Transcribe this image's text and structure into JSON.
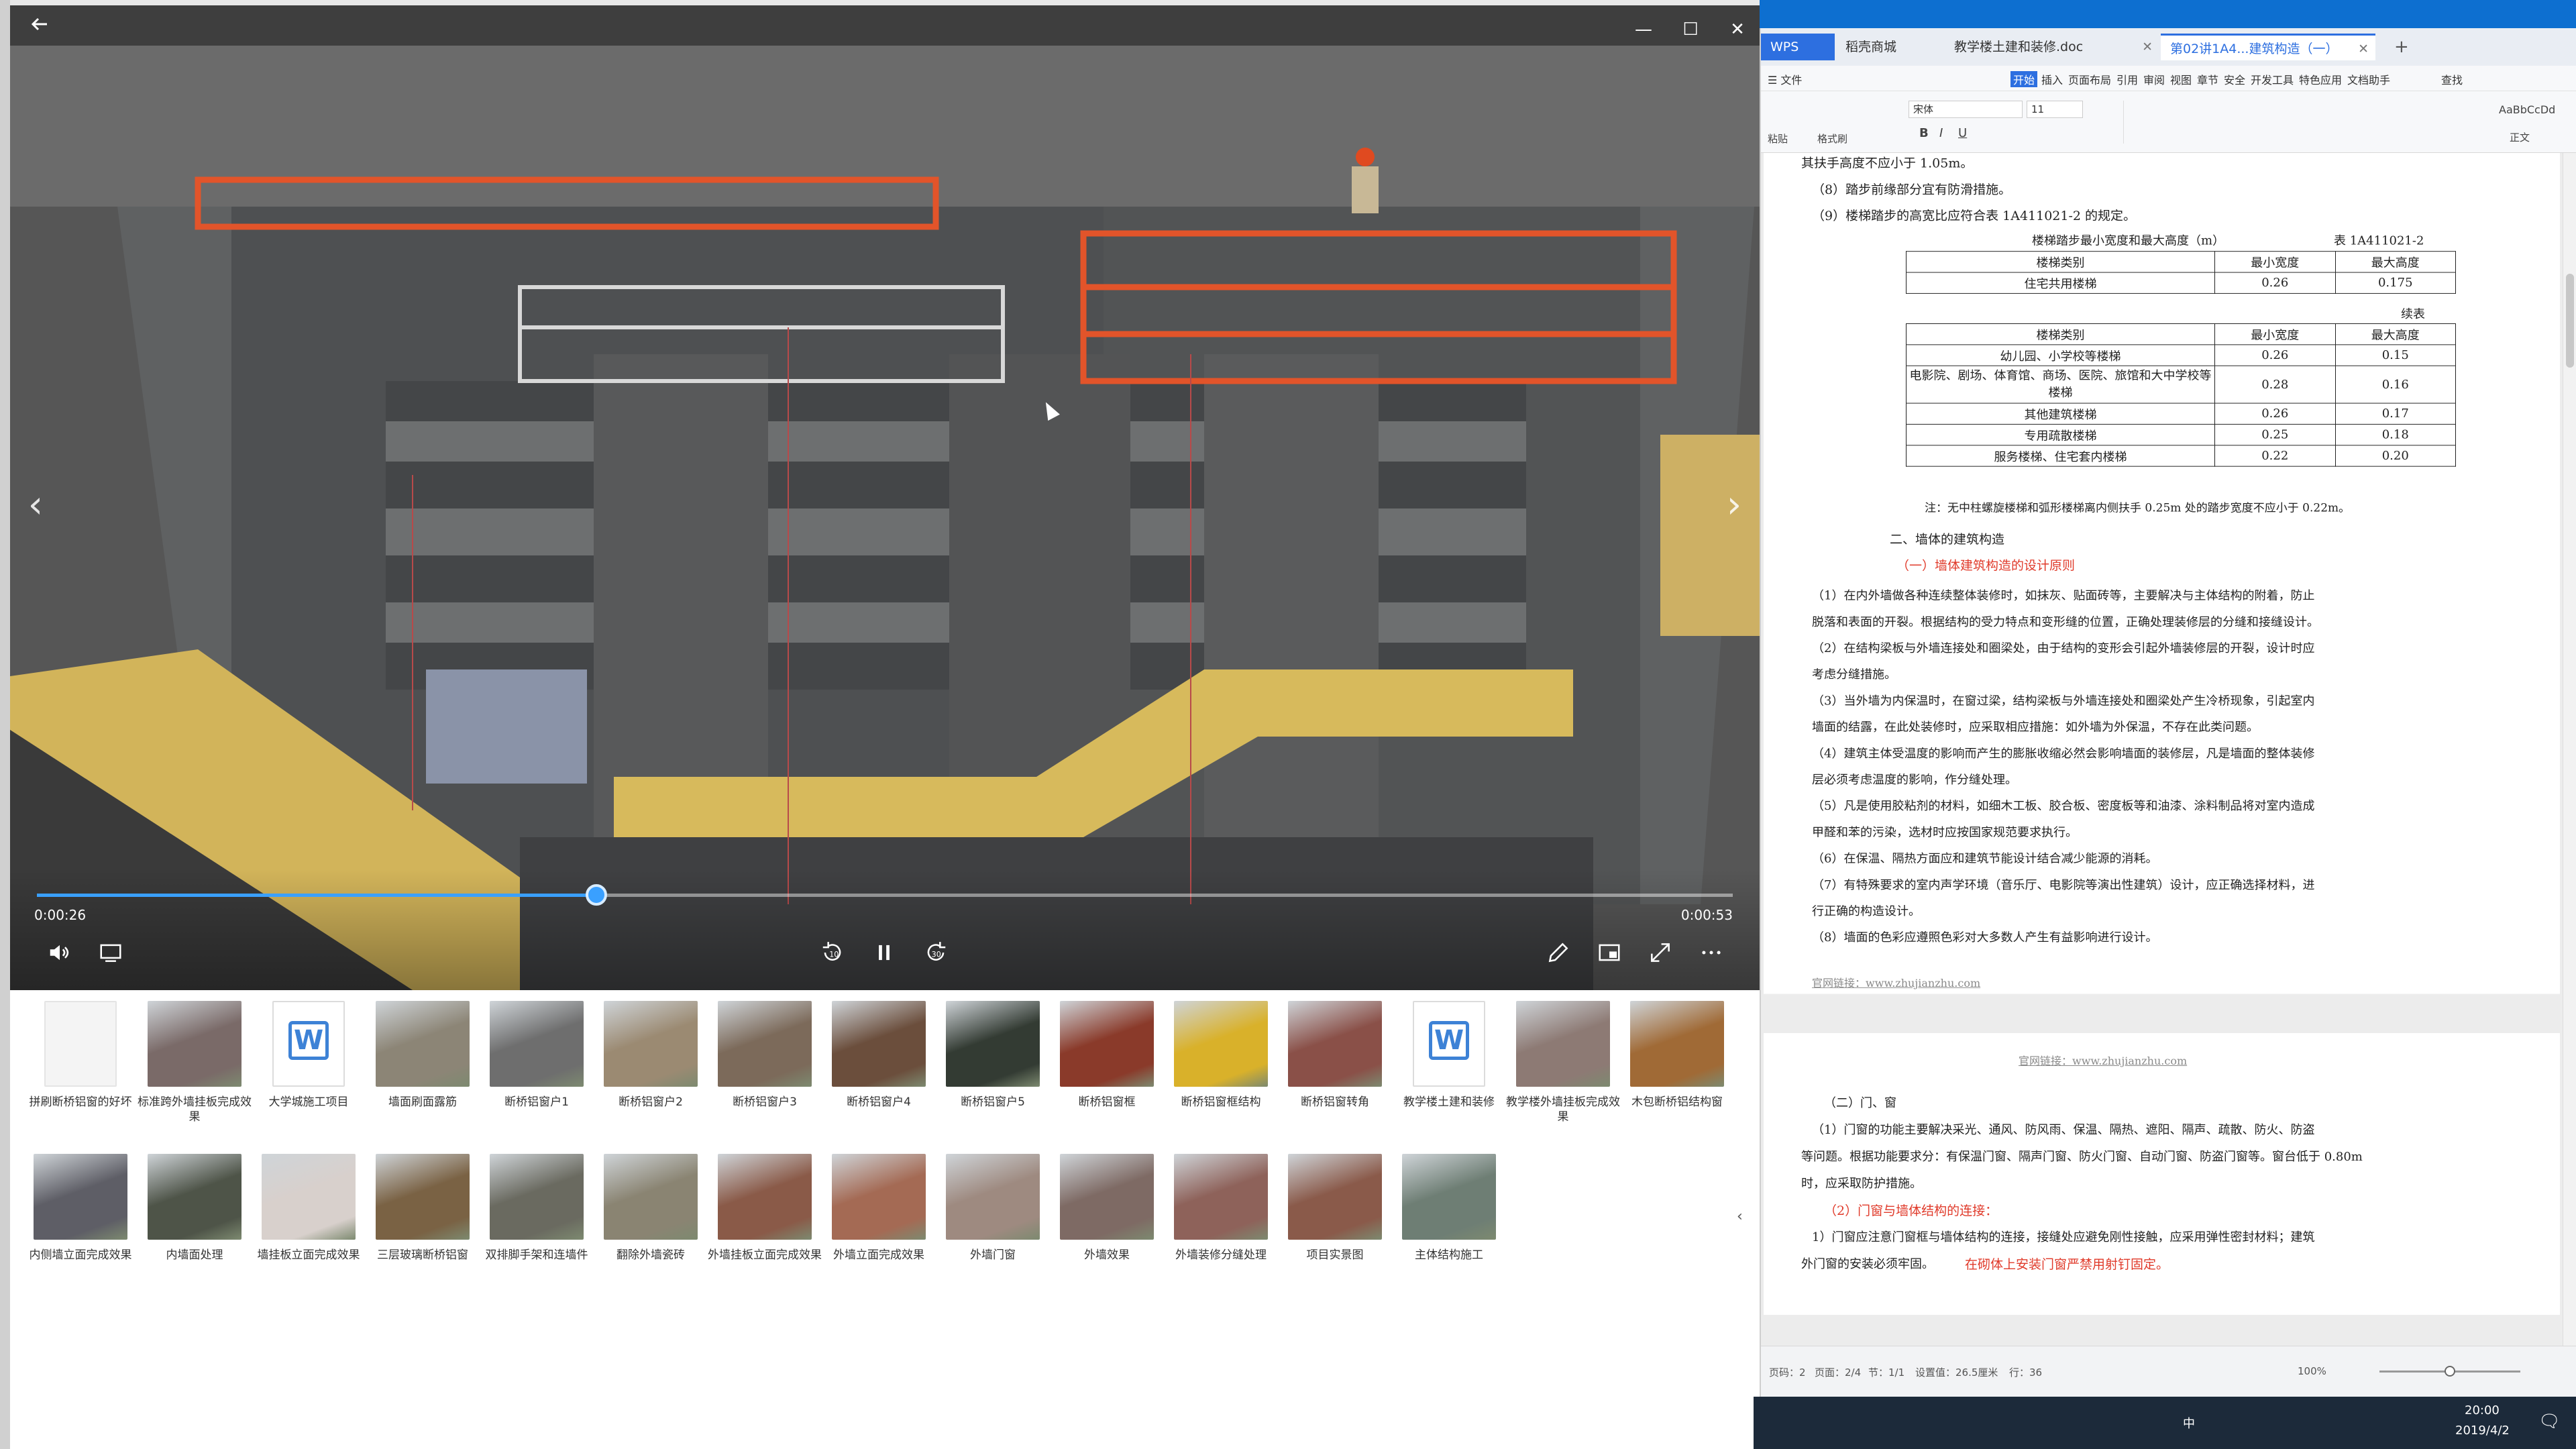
{
  "player": {
    "back_icon": "back-arrow-icon",
    "minimize_glyph": "—",
    "maximize_glyph": "☐",
    "close_glyph": "✕",
    "prev_glyph": "‹",
    "next_glyph": "›",
    "time_current": "0:00:26",
    "time_total": "0:00:53",
    "progress": 0.33,
    "rewind_label": "10",
    "forward_label": "30"
  },
  "gallery": {
    "row1": [
      {
        "label": "拼刷断桥铝窗的好坏",
        "kind": "blank"
      },
      {
        "label": "标准跨外墙挂板完成效果",
        "kind": "photo",
        "color": "#7a6a68"
      },
      {
        "label": "大学城施工项目",
        "kind": "doc"
      },
      {
        "label": "墙面刷面露筋",
        "kind": "photo",
        "color": "#8c8576"
      },
      {
        "label": "断桥铝窗户1",
        "kind": "photo",
        "color": "#6e6e6e"
      },
      {
        "label": "断桥铝窗户2",
        "kind": "photo",
        "color": "#9b8a72"
      },
      {
        "label": "断桥铝窗户3",
        "kind": "photo",
        "color": "#7c6a5a"
      },
      {
        "label": "断桥铝窗户4",
        "kind": "photo",
        "color": "#6b4e3c"
      },
      {
        "label": "断桥铝窗户5",
        "kind": "photo",
        "color": "#333b33"
      },
      {
        "label": "断桥铝窗框",
        "kind": "photo",
        "color": "#8a3a2a"
      },
      {
        "label": "断桥铝窗框结构",
        "kind": "photo",
        "color": "#d9b12a"
      },
      {
        "label": "断桥铝窗转角",
        "kind": "photo",
        "color": "#8a5048"
      },
      {
        "label": "教学楼土建和装修",
        "kind": "doc"
      },
      {
        "label": "教学楼外墙挂板完成效果",
        "kind": "photo",
        "color": "#8d7a74"
      },
      {
        "label": "木包断桥铝结构窗",
        "kind": "photo",
        "color": "#a06a36"
      }
    ],
    "row2": [
      {
        "label": "内侧墙立面完成效果",
        "kind": "photo",
        "color": "#5e5e66"
      },
      {
        "label": "内墙面处理",
        "kind": "photo",
        "color": "#4e5448"
      },
      {
        "label": "墙挂板立面完成效果",
        "kind": "photo",
        "color": "#d8d0cc"
      },
      {
        "label": "三层玻璃断桥铝窗",
        "kind": "photo",
        "color": "#7a6244"
      },
      {
        "label": "双排脚手架和连墙件",
        "kind": "photo",
        "color": "#6a6a60"
      },
      {
        "label": "翻除外墙瓷砖",
        "kind": "photo",
        "color": "#8a8472"
      },
      {
        "label": "外墙挂板立面完成效果",
        "kind": "photo",
        "color": "#8a5a48"
      },
      {
        "label": "外墙立面完成效果",
        "kind": "photo",
        "color": "#a46a54"
      },
      {
        "label": "外墙门窗",
        "kind": "photo",
        "color": "#9e8a80"
      },
      {
        "label": "外墙效果",
        "kind": "photo",
        "color": "#7e6a64"
      },
      {
        "label": "外墙装修分缝处理",
        "kind": "photo",
        "color": "#8e625a"
      },
      {
        "label": "项目实景图",
        "kind": "photo",
        "color": "#8a5a4a"
      },
      {
        "label": "主体结构施工",
        "kind": "photo",
        "color": "#6e7e74"
      }
    ]
  },
  "wps": {
    "tabs": [
      {
        "label": "WPS"
      },
      {
        "label": "稻壳商城"
      },
      {
        "label": "教学楼土建和装修.doc"
      },
      {
        "label": "第02讲1A4...建筑构造（一）"
      }
    ],
    "menu": [
      "☰ 文件",
      "开始",
      "插入",
      "页面布局",
      "引用",
      "审阅",
      "视图",
      "章节",
      "安全",
      "开发工具",
      "特色应用",
      "文档助手",
      "查找"
    ],
    "ribbon": {
      "paste": "粘贴",
      "format_painter": "格式刷",
      "font": "宋体",
      "size": "11",
      "style": "AaBbCcDd",
      "style_name": "正文"
    },
    "page1": {
      "line0": "其扶手高度不应小于 1.05m。",
      "line1": "（8）踏步前缘部分宜有防滑措施。",
      "line2": "（9）楼梯踏步的高宽比应符合表 1A411021-2 的规定。",
      "table_title": "楼梯踏步最小宽度和最大高度（m）",
      "table_no": "表 1A411021-2",
      "head": [
        "楼梯类别",
        "最小宽度",
        "最大高度"
      ],
      "row_a": [
        "住宅共用楼梯",
        "0.26",
        "0.175"
      ],
      "continued": "续表",
      "head2": [
        "楼梯类别",
        "最小宽度",
        "最大高度"
      ],
      "rows": [
        [
          "幼儿园、小学校等楼梯",
          "0.26",
          "0.15"
        ],
        [
          "电影院、剧场、体育馆、商场、医院、旅馆和大中学校等楼梯",
          "0.28",
          "0.16"
        ],
        [
          "其他建筑楼梯",
          "0.26",
          "0.17"
        ],
        [
          "专用疏散楼梯",
          "0.25",
          "0.18"
        ],
        [
          "服务楼梯、住宅套内楼梯",
          "0.22",
          "0.20"
        ]
      ],
      "note": "注：无中柱螺旋楼梯和弧形楼梯离内侧扶手 0.25m 处的踏步宽度不应小于 0.22m。",
      "h2": "二、墙体的建筑构造",
      "h3": "（一）墙体建筑构造的设计原则",
      "para1a": "（1）在内外墙做各种连续整体装修时，如抹灰、贴面砖等，主要解决与主体结构的附着，防止",
      "para1b": "脱落和表面的开裂。根据结构的受力特点和变形缝的位置，正确处理装修层的分缝和接缝设计。",
      "para2a": "（2）在结构梁板与外墙连接处和圈梁处，由于结构的变形会引起外墙装修层的开裂，设计时应",
      "para2b": "考虑分缝措施。",
      "para3a": "（3）当外墙为内保温时，在窗过梁，结构梁板与外墙连接处和圈梁处产生冷桥现象，引起室内",
      "para3b": "墙面的结露，在此处装修时，应采取相应措施：如外墙为外保温，不存在此类问题。",
      "para4a": "（4）建筑主体受温度的影响而产生的膨胀收缩必然会影响墙面的装修层，凡是墙面的整体装修",
      "para4b": "层必须考虑温度的影响，作分缝处理。",
      "para5a": "（5）凡是使用胶粘剂的材料，如细木工板、胶合板、密度板等和油漆、涂料制品将对室内造成",
      "para5b": "甲醛和苯的污染，选材时应按国家规范要求执行。",
      "para6": "（6）在保温、隔热方面应和建筑节能设计结合减少能源的消耗。",
      "para7a": "（7）有特殊要求的室内声学环境（音乐厅、电影院等演出性建筑）设计，应正确选择材料，进",
      "para7b": "行正确的构造设计。",
      "para8": "（8）墙面的色彩应遵照色彩对大多数人产生有益影响进行设计。",
      "footer_link": "官网链接：www.zhujianzhu.com"
    },
    "page2": {
      "header_link": "官网链接：www.zhujianzhu.com",
      "h3": "（二）门、窗",
      "para1a": "（1）门窗的功能主要解决采光、通风、防风雨、保温、隔热、遮阳、隔声、疏散、防火、防盗",
      "para1b": "等问题。根据功能要求分：有保温门窗、隔声门窗、防火门窗、自动门窗、防盗门窗等。窗台低于 0.80m",
      "para1c": "时，应采取防护措施。",
      "h4": "（2）门窗与墙体结构的连接：",
      "para2a": "1）门窗应注意门窗框与墙体结构的连接，接缝处应避免刚性接触，应采用弹性密封材料；建筑",
      "para2b": "外门窗的安装必须牢固。",
      "para2c": "在砌体上安装门窗严禁用射钉固定。"
    },
    "status": {
      "page_num": "页码：2",
      "page_count": "页面：2/4",
      "section": "节：1/1",
      "settings": "设置值：26.5厘米",
      "line": "行：36",
      "zoom": "100%",
      "zoom_level": 0.5
    }
  },
  "taskbar": {
    "time": "20:00",
    "date": "2019/4/2",
    "lang": "中"
  }
}
